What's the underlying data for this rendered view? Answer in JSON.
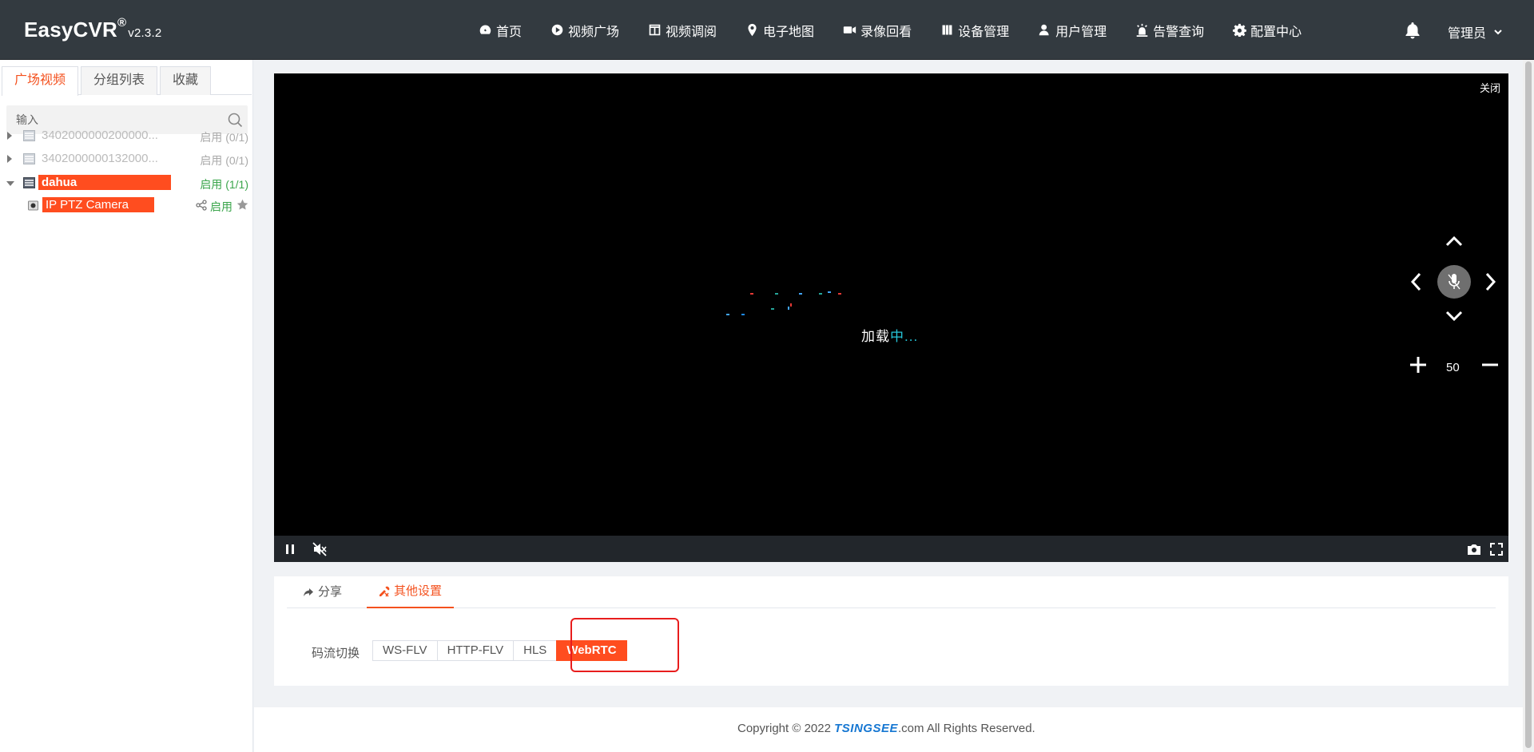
{
  "app": {
    "logo": "EasyCVR",
    "logo_reg": "®",
    "version": "v2.3.2"
  },
  "nav": {
    "items": [
      {
        "label": "首页",
        "icon": "dashboard-icon"
      },
      {
        "label": "视频广场",
        "icon": "play-circle-icon"
      },
      {
        "label": "视频调阅",
        "icon": "grid-icon"
      },
      {
        "label": "电子地图",
        "icon": "map-marker-icon"
      },
      {
        "label": "录像回看",
        "icon": "video-camera-icon"
      },
      {
        "label": "设备管理",
        "icon": "device-icon"
      },
      {
        "label": "用户管理",
        "icon": "user-icon"
      },
      {
        "label": "告警查询",
        "icon": "alarm-icon"
      },
      {
        "label": "配置中心",
        "icon": "gear-icon"
      }
    ],
    "user": "管理员"
  },
  "sidebar": {
    "tabs": [
      "广场视频",
      "分组列表",
      "收藏"
    ],
    "active_tab": 0,
    "search_placeholder": "输入",
    "tree": [
      {
        "name": "3402000000200000...",
        "status": "启用 (0/1)",
        "expanded": false,
        "active": false
      },
      {
        "name": "3402000000132000...",
        "status": "启用 (0/1)",
        "expanded": false,
        "active": false
      },
      {
        "name": "dahua",
        "status": "启用 (1/1)",
        "expanded": true,
        "active": true
      }
    ],
    "camera": {
      "name": "IP PTZ Camera",
      "status": "启用"
    }
  },
  "player": {
    "close_label": "关闭",
    "loading_prefix": "加载",
    "loading_suffix": "中...",
    "zoom_value": "50"
  },
  "settings": {
    "tabs": [
      "分享",
      "其他设置"
    ],
    "active_tab": 1,
    "stream_label": "码流切换",
    "stream_options": [
      "WS-FLV",
      "HTTP-FLV",
      "HLS",
      "WebRTC"
    ],
    "active_stream": "WebRTC"
  },
  "footer": {
    "prefix": "Copyright © 2022 ",
    "brand": "TSINGSEE",
    "suffix": ".com All Rights Reserved."
  },
  "colors": {
    "accent": "#ff4d1f",
    "header_bg": "#333a40",
    "enabled_green": "#3aa54b",
    "highlight_red": "#e81d1d"
  }
}
